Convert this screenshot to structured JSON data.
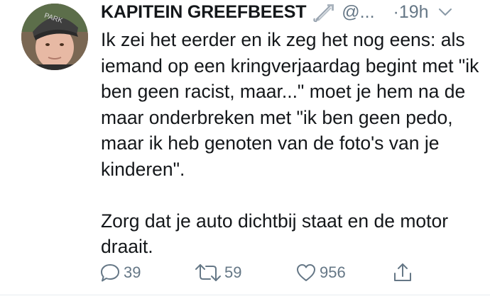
{
  "tweet": {
    "display_name": "KAPITEIN GREEFBEEST",
    "name_emoji": "safety-pin",
    "handle": "@...",
    "time_separator": "·",
    "time": "19h",
    "text": "Ik zei het eerder en ik zeg het nog eens: als iemand op een kringverjaardag begint met \"ik ben geen racist, maar...\" moet je hem na de maar onderbreken met \"ik ben geen pedo, maar ik heb genoten van de foto's van je kinderen\".\n\nZorg dat je auto dichtbij staat en de motor draait.",
    "avatar_cap_text": "PARK"
  },
  "actions": {
    "reply_count": "39",
    "retweet_count": "59",
    "like_count": "956"
  },
  "colors": {
    "text": "#14171a",
    "secondary": "#657786",
    "divider": "#e6ecf0"
  },
  "icons": [
    "avatar-photo",
    "safety-pin-icon",
    "chevron-down-icon",
    "reply-icon",
    "retweet-icon",
    "heart-icon",
    "share-icon"
  ]
}
